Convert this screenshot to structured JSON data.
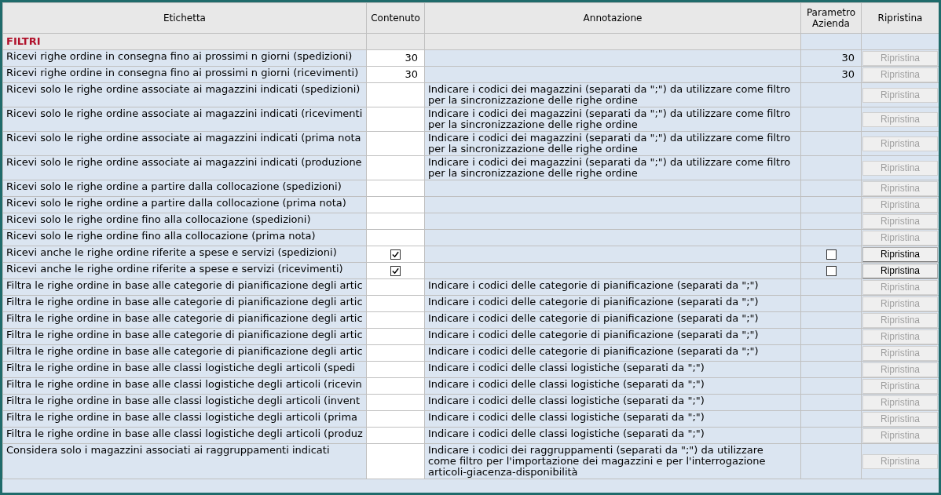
{
  "table": {
    "columns": [
      "Etichetta",
      "Contenuto",
      "Annotazione",
      "Parametro Azienda",
      "Ripristina"
    ],
    "section": "FILTRI",
    "rows": [
      {
        "label": "Ricevi righe ordine in consegna fino ai prossimi n giorni (spedizioni)",
        "content": {
          "kind": "number",
          "value": "30"
        },
        "annotation": "",
        "parameter": {
          "kind": "number",
          "value": "30"
        },
        "reset": {
          "label": "Ripristina",
          "disabled": true
        }
      },
      {
        "label": "Ricevi righe ordine in consegna fino ai prossimi n giorni (ricevimenti)",
        "content": {
          "kind": "number",
          "value": "30"
        },
        "annotation": "",
        "parameter": {
          "kind": "number",
          "value": "30"
        },
        "reset": {
          "label": "Ripristina",
          "disabled": true
        }
      },
      {
        "label": "Ricevi solo le righe ordine associate ai magazzini indicati (spedizioni)",
        "content": {
          "kind": "text"
        },
        "annotation": "Indicare i codici dei magazzini (separati da \";\") da utilizzare come filtro per la sincronizzazione delle righe ordine",
        "parameter": {
          "kind": "none"
        },
        "reset": {
          "label": "Ripristina",
          "disabled": true
        }
      },
      {
        "label": "Ricevi solo le righe ordine associate ai magazzini indicati (ricevimenti",
        "content": {
          "kind": "text"
        },
        "annotation": "Indicare i codici dei magazzini (separati da \";\") da utilizzare come filtro per la sincronizzazione delle righe ordine",
        "parameter": {
          "kind": "none"
        },
        "reset": {
          "label": "Ripristina",
          "disabled": true
        }
      },
      {
        "label": "Ricevi solo le righe ordine associate ai magazzini indicati (prima nota",
        "content": {
          "kind": "text"
        },
        "annotation": "Indicare i codici dei magazzini (separati da \";\") da utilizzare come filtro per la sincronizzazione delle righe ordine",
        "parameter": {
          "kind": "none"
        },
        "reset": {
          "label": "Ripristina",
          "disabled": true
        }
      },
      {
        "label": "Ricevi solo le righe ordine associate ai magazzini indicati (produzione",
        "content": {
          "kind": "text"
        },
        "annotation": "Indicare i codici dei magazzini (separati da \";\") da utilizzare come filtro per la sincronizzazione delle righe ordine",
        "parameter": {
          "kind": "none"
        },
        "reset": {
          "label": "Ripristina",
          "disabled": true
        }
      },
      {
        "label": "Ricevi solo le righe ordine a partire dalla collocazione (spedizioni)",
        "content": {
          "kind": "text"
        },
        "annotation": "",
        "parameter": {
          "kind": "none"
        },
        "reset": {
          "label": "Ripristina",
          "disabled": true
        }
      },
      {
        "label": "Ricevi solo le righe ordine a partire dalla collocazione (prima nota)",
        "content": {
          "kind": "text"
        },
        "annotation": "",
        "parameter": {
          "kind": "none"
        },
        "reset": {
          "label": "Ripristina",
          "disabled": true
        }
      },
      {
        "label": "Ricevi solo le righe ordine fino alla collocazione (spedizioni)",
        "content": {
          "kind": "text"
        },
        "annotation": "",
        "parameter": {
          "kind": "none"
        },
        "reset": {
          "label": "Ripristina",
          "disabled": true
        }
      },
      {
        "label": "Ricevi solo le righe ordine fino alla collocazione (prima nota)",
        "content": {
          "kind": "text"
        },
        "annotation": "",
        "parameter": {
          "kind": "none"
        },
        "reset": {
          "label": "Ripristina",
          "disabled": true
        }
      },
      {
        "label": "Ricevi anche le righe ordine riferite a spese e servizi (spedizioni)",
        "content": {
          "kind": "check",
          "checked": true
        },
        "annotation": "",
        "parameter": {
          "kind": "check",
          "checked": false
        },
        "reset": {
          "label": "Ripristina",
          "disabled": false
        }
      },
      {
        "label": "Ricevi anche le righe ordine riferite a spese e servizi (ricevimenti)",
        "content": {
          "kind": "check",
          "checked": true
        },
        "annotation": "",
        "parameter": {
          "kind": "check",
          "checked": false
        },
        "reset": {
          "label": "Ripristina",
          "disabled": false
        }
      },
      {
        "label": "Filtra le righe ordine in base alle categorie di pianificazione degli artic",
        "content": {
          "kind": "text"
        },
        "annotation": "Indicare i codici delle categorie di pianificazione (separati da \";\")",
        "parameter": {
          "kind": "none"
        },
        "reset": {
          "label": "Ripristina",
          "disabled": true
        }
      },
      {
        "label": "Filtra le righe ordine in base alle categorie di pianificazione degli artic",
        "content": {
          "kind": "text"
        },
        "annotation": "Indicare i codici delle categorie di pianificazione (separati da \";\")",
        "parameter": {
          "kind": "none"
        },
        "reset": {
          "label": "Ripristina",
          "disabled": true
        }
      },
      {
        "label": "Filtra le righe ordine in base alle categorie di pianificazione degli artic",
        "content": {
          "kind": "text"
        },
        "annotation": "Indicare i codici delle categorie di pianificazione (separati da \";\")",
        "parameter": {
          "kind": "none"
        },
        "reset": {
          "label": "Ripristina",
          "disabled": true
        }
      },
      {
        "label": "Filtra le righe ordine in base alle categorie di pianificazione degli artic",
        "content": {
          "kind": "text"
        },
        "annotation": "Indicare i codici delle categorie di pianificazione (separati da \";\")",
        "parameter": {
          "kind": "none"
        },
        "reset": {
          "label": "Ripristina",
          "disabled": true
        }
      },
      {
        "label": "Filtra le righe ordine in base alle categorie di pianificazione degli artic",
        "content": {
          "kind": "text"
        },
        "annotation": "Indicare i codici delle categorie di pianificazione (separati da \";\")",
        "parameter": {
          "kind": "none"
        },
        "reset": {
          "label": "Ripristina",
          "disabled": true
        }
      },
      {
        "label": "Filtra le righe ordine in base alle classi logistiche degli articoli (spedi",
        "content": {
          "kind": "text"
        },
        "annotation": "Indicare i codici delle classi logistiche (separati da \";\")",
        "parameter": {
          "kind": "none"
        },
        "reset": {
          "label": "Ripristina",
          "disabled": true
        }
      },
      {
        "label": "Filtra le righe ordine in base alle classi logistiche degli articoli (ricevin",
        "content": {
          "kind": "text"
        },
        "annotation": "Indicare i codici delle classi logistiche (separati da \";\")",
        "parameter": {
          "kind": "none"
        },
        "reset": {
          "label": "Ripristina",
          "disabled": true
        }
      },
      {
        "label": "Filtra le righe ordine in base alle classi logistiche degli articoli (invent",
        "content": {
          "kind": "text"
        },
        "annotation": "Indicare i codici delle classi logistiche (separati da \";\")",
        "parameter": {
          "kind": "none"
        },
        "reset": {
          "label": "Ripristina",
          "disabled": true
        }
      },
      {
        "label": "Filtra le righe ordine in base alle classi logistiche degli articoli (prima",
        "content": {
          "kind": "text"
        },
        "annotation": "Indicare i codici delle classi logistiche (separati da \";\")",
        "parameter": {
          "kind": "none"
        },
        "reset": {
          "label": "Ripristina",
          "disabled": true
        }
      },
      {
        "label": "Filtra le righe ordine in base alle classi logistiche degli articoli (produz",
        "content": {
          "kind": "text"
        },
        "annotation": "Indicare i codici delle classi logistiche (separati da \";\")",
        "parameter": {
          "kind": "none"
        },
        "reset": {
          "label": "Ripristina",
          "disabled": true
        }
      },
      {
        "label": "Considera solo i magazzini associati ai raggruppamenti indicati",
        "content": {
          "kind": "text"
        },
        "annotation": "Indicare i codici dei raggruppamenti (separati da \";\") da utilizzare come filtro per l'importazione dei magazzini e per l'interrogazione articoli-giacenza-disponibilità",
        "parameter": {
          "kind": "none"
        },
        "reset": {
          "label": "Ripristina",
          "disabled": true
        }
      }
    ]
  }
}
